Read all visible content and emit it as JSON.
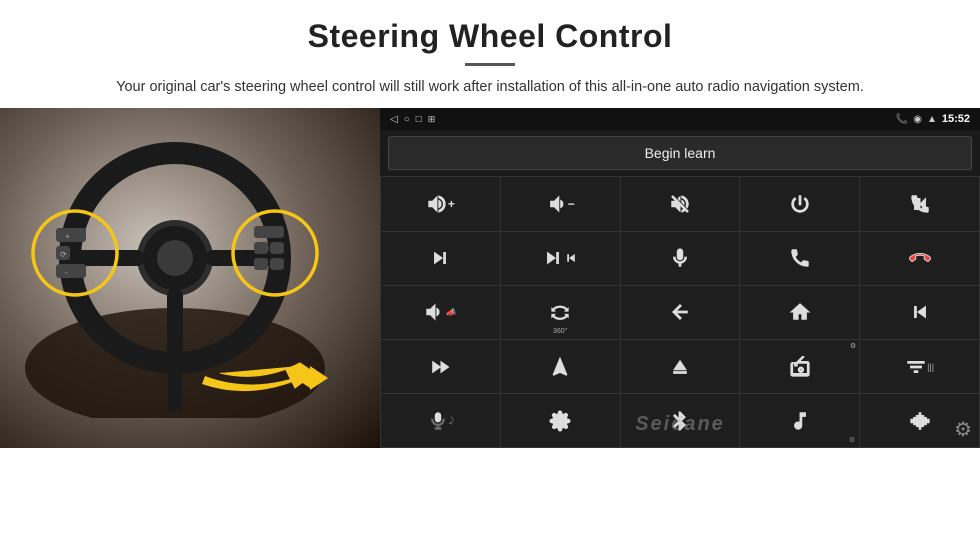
{
  "header": {
    "title": "Steering Wheel Control",
    "subtitle": "Your original car's steering wheel control will still work after installation of this all-in-one auto radio navigation system."
  },
  "screen": {
    "status_bar": {
      "time": "15:52",
      "icons": [
        "phone",
        "location",
        "wifi",
        "signal"
      ]
    },
    "begin_learn_label": "Begin learn",
    "nav_icons": [
      "back",
      "home",
      "recents"
    ],
    "control_buttons": [
      {
        "icon": "vol_up",
        "symbol": "🔊+"
      },
      {
        "icon": "vol_down",
        "symbol": "🔉−"
      },
      {
        "icon": "vol_mute",
        "symbol": "🔇"
      },
      {
        "icon": "power",
        "symbol": "⏻"
      },
      {
        "icon": "call_prev",
        "symbol": "📞⏮"
      },
      {
        "icon": "next_track",
        "symbol": "⏭"
      },
      {
        "icon": "seek_fwd",
        "symbol": "⏩"
      },
      {
        "icon": "mic",
        "symbol": "🎤"
      },
      {
        "icon": "phone",
        "symbol": "📞"
      },
      {
        "icon": "hang_up",
        "symbol": "📵"
      },
      {
        "icon": "horn",
        "symbol": "📣"
      },
      {
        "icon": "360_view",
        "symbol": "360°"
      },
      {
        "icon": "back",
        "symbol": "↩"
      },
      {
        "icon": "home",
        "symbol": "🏠"
      },
      {
        "icon": "prev_track2",
        "symbol": "⏮"
      },
      {
        "icon": "fast_fwd",
        "symbol": "⏩"
      },
      {
        "icon": "nav",
        "symbol": "▶"
      },
      {
        "icon": "eject",
        "symbol": "⏏"
      },
      {
        "icon": "radio",
        "symbol": "📻"
      },
      {
        "icon": "equalizer",
        "symbol": "🎛"
      },
      {
        "icon": "mic2",
        "symbol": "🎙"
      },
      {
        "icon": "settings_wheel",
        "symbol": "⚙"
      },
      {
        "icon": "bluetooth",
        "symbol": "⚡"
      },
      {
        "icon": "music",
        "symbol": "🎵"
      },
      {
        "icon": "waveform",
        "symbol": "📶"
      }
    ],
    "watermark": "Seicane",
    "gear_icon": "⚙"
  }
}
